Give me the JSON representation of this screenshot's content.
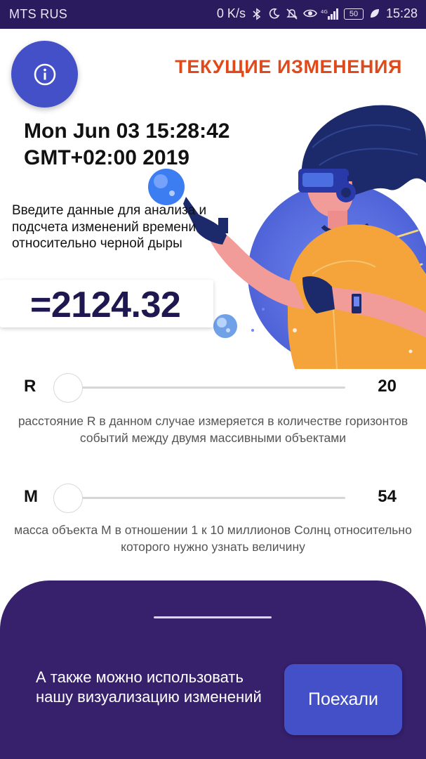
{
  "status_bar": {
    "carrier": "MTS RUS",
    "net_speed": "0 K/s",
    "battery": "50",
    "time": "15:28",
    "icons": [
      "bluetooth-icon",
      "moon-icon",
      "mute-icon",
      "eye-icon",
      "signal-4g-icon",
      "battery-icon",
      "leaf-icon"
    ]
  },
  "header": {
    "title": "ТЕКУЩИЕ ИЗМЕНЕНИЯ",
    "info_icon": "info-icon"
  },
  "main": {
    "datetime": "Mon Jun 03 15:28:42 GMT+02:00 2019",
    "prompt": "Введите данные для анализа и подсчета изменений времени относительно черной дыры",
    "result": "=2124.32"
  },
  "sliders": [
    {
      "label": "R",
      "value": "20",
      "position_fraction": 0.0,
      "description": "расстояние R в данном случае измеряется в количестве горизонтов событий между двумя массивными объектами"
    },
    {
      "label": "M",
      "value": "54",
      "position_fraction": 0.0,
      "description": "масса объекта М в отношении 1 к 10 миллионов Солнц относительно которого нужно узнать величину"
    }
  ],
  "bottom_sheet": {
    "text": "А также можно использовать нашу визуализацию изменений",
    "button_label": "Поехали"
  },
  "colors": {
    "status_bar": "#2a1a5e",
    "accent_blue": "#4350c8",
    "title_orange": "#e04a1a",
    "sheet_purple": "#37206c",
    "result_text": "#1f1750"
  }
}
